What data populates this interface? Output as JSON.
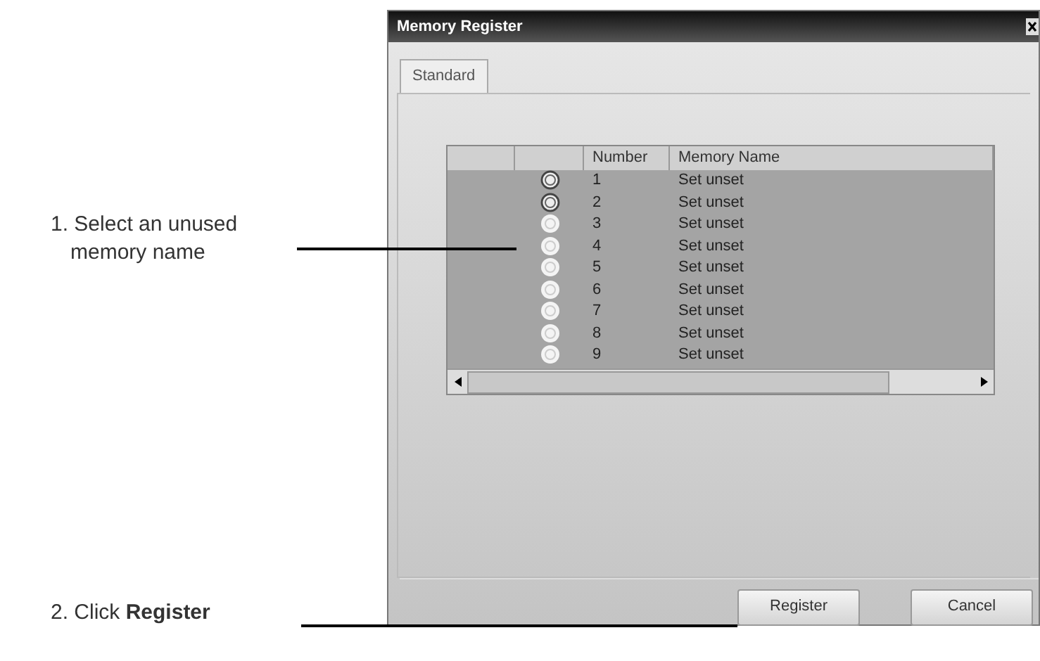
{
  "callouts": [
    {
      "text": "1. Select an unused memory name"
    },
    {
      "text": "2. Click **Register**"
    }
  ],
  "dialog": {
    "title": "Memory Register",
    "tabs": [
      {
        "label": "Standard",
        "selected": true
      }
    ],
    "table": {
      "columns": [
        "Number",
        "Memory Name"
      ],
      "rows": [
        {
          "registered": true,
          "number": "1",
          "name": "Set unset"
        },
        {
          "registered": true,
          "number": "2",
          "name": "Set unset"
        },
        {
          "registered": false,
          "number": "3",
          "name": "Set unset"
        },
        {
          "registered": false,
          "number": "4",
          "name": "Set unset"
        },
        {
          "registered": false,
          "number": "5",
          "name": "Set unset"
        },
        {
          "registered": false,
          "number": "6",
          "name": "Set unset"
        },
        {
          "registered": false,
          "number": "7",
          "name": "Set unset"
        },
        {
          "registered": false,
          "number": "8",
          "name": "Set unset"
        },
        {
          "registered": false,
          "number": "9",
          "name": "Set unset"
        }
      ]
    },
    "buttons": [
      "Register",
      "Cancel"
    ]
  }
}
